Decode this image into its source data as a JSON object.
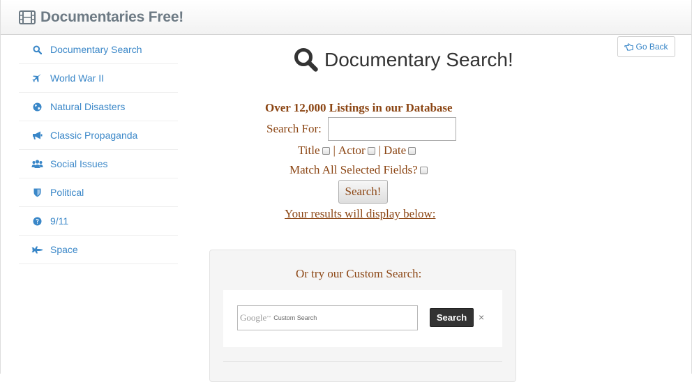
{
  "brand": {
    "title": "Documentaries Free!",
    "icon": "film-icon"
  },
  "sidebar": {
    "items": [
      {
        "label": "Documentary Search",
        "icon": "search-icon"
      },
      {
        "label": "World War II",
        "icon": "plane-icon"
      },
      {
        "label": "Natural Disasters",
        "icon": "globe-icon"
      },
      {
        "label": "Classic Propaganda",
        "icon": "bullhorn-icon"
      },
      {
        "label": "Social Issues",
        "icon": "users-icon"
      },
      {
        "label": "Political",
        "icon": "shield-icon"
      },
      {
        "label": "9/11",
        "icon": "question-circle-icon"
      },
      {
        "label": "Space",
        "icon": "space-shuttle-icon"
      }
    ]
  },
  "toolbar": {
    "go_back_label": "Go Back"
  },
  "main": {
    "title": "Documentary Search!",
    "listings_text": "Over 12,000 Listings in our Database",
    "search_for_label": "Search For:",
    "search_value": "",
    "fields": {
      "title": "Title",
      "actor": "Actor",
      "date": "Date",
      "separator": "|"
    },
    "match_all_label": "Match All Selected Fields?",
    "search_button": "Search!",
    "results_text": "Your results will display below:"
  },
  "custom_search": {
    "heading": "Or try our Custom Search:",
    "google_logo": "Google",
    "tm": "™",
    "placeholder_label": "Custom Search",
    "button": "Search",
    "clear": "×"
  },
  "colors": {
    "link": "#3a87c8",
    "accent_text": "#8b4513",
    "brand": "#6d7a84"
  }
}
